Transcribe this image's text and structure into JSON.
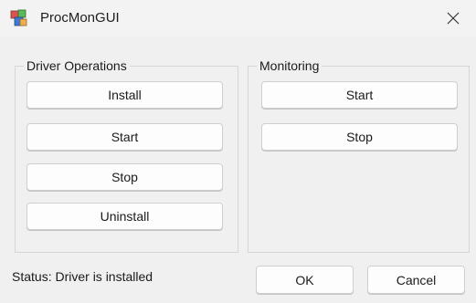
{
  "window": {
    "title": "ProcMonGUI",
    "icon": "app-cubes-icon",
    "close_icon": "close-icon"
  },
  "driver_operations": {
    "label": "Driver Operations",
    "buttons": [
      "Install",
      "Start",
      "Stop",
      "Uninstall"
    ]
  },
  "monitoring": {
    "label": "Monitoring",
    "buttons": [
      "Start",
      "Stop"
    ]
  },
  "status": "Status: Driver is installed",
  "footer": {
    "ok_label": "OK",
    "cancel_label": "Cancel"
  }
}
